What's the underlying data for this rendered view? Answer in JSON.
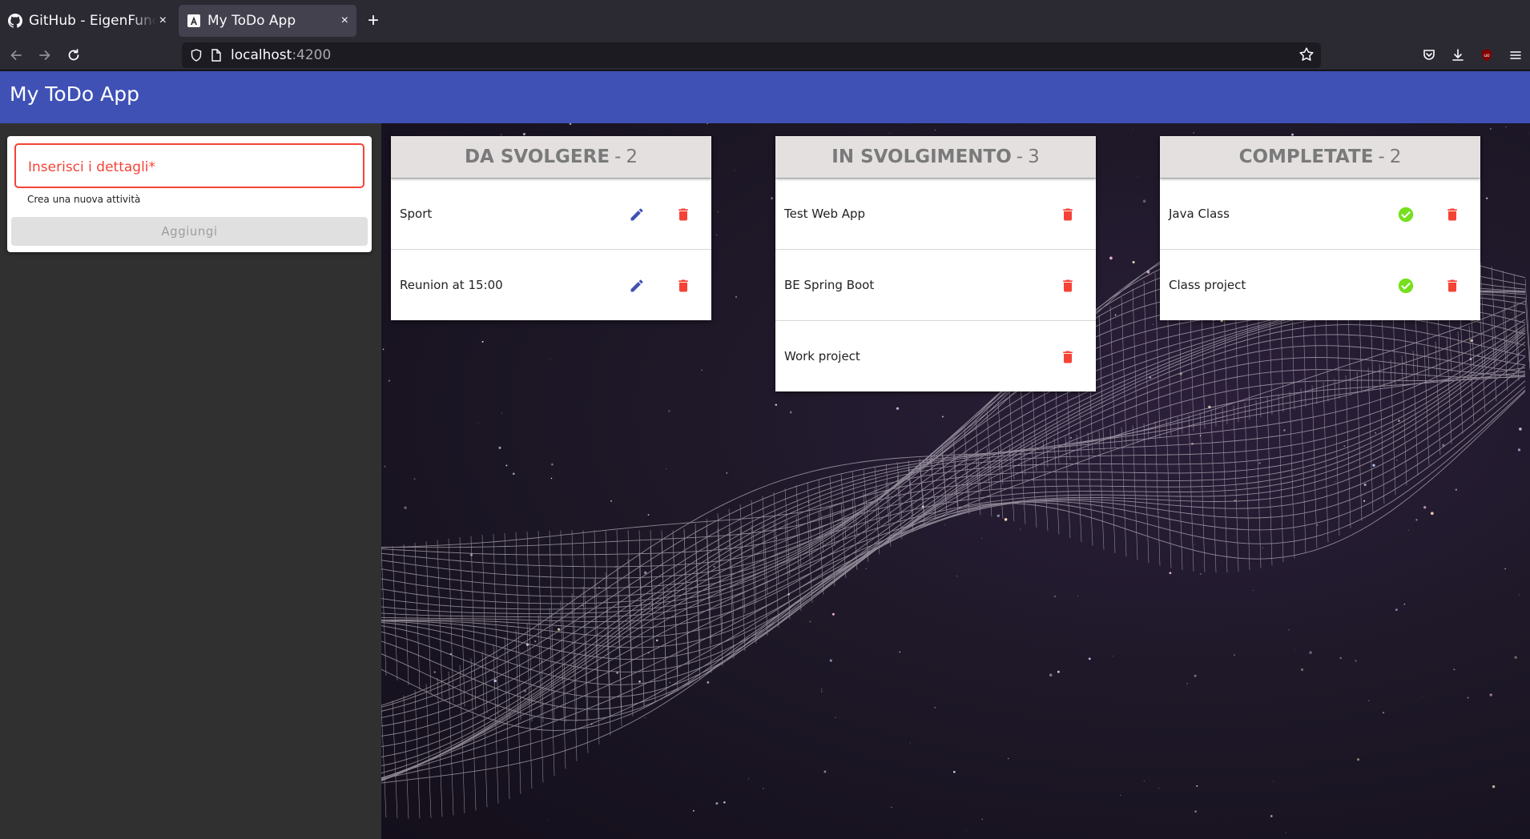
{
  "browser": {
    "tabs": [
      {
        "title": "GitHub - EigenFunction",
        "favicon": "github-icon",
        "active": false
      },
      {
        "title": "My ToDo App",
        "favicon": "angular-icon",
        "active": true
      }
    ],
    "close_glyph": "×",
    "new_tab_glyph": "+",
    "url_host": "localhost",
    "url_port": ":4200"
  },
  "app": {
    "title": "My ToDo App"
  },
  "form": {
    "label": "Inserisci i dettagli*",
    "hint": "Crea una nuova attività",
    "button": "Aggiungi",
    "error_color": "#f44336"
  },
  "columns": [
    {
      "name": "DA SVOLGERE",
      "separator": "-",
      "count": "2",
      "tasks": [
        {
          "label": "Sport"
        },
        {
          "label": "Reunion at 15:00"
        }
      ],
      "actions": [
        "edit-icon",
        "delete-icon"
      ]
    },
    {
      "name": "IN SVOLGIMENTO",
      "separator": "-",
      "count": "3",
      "tasks": [
        {
          "label": "Test Web App"
        },
        {
          "label": "BE Spring Boot"
        },
        {
          "label": "Work project"
        }
      ],
      "actions": [
        "delete-icon"
      ]
    },
    {
      "name": "COMPLETATE",
      "separator": "-",
      "count": "2",
      "tasks": [
        {
          "label": "Java Class"
        },
        {
          "label": "Class project"
        }
      ],
      "actions": [
        "check-icon",
        "delete-icon"
      ]
    }
  ],
  "colors": {
    "toolbar": "#3f51b5",
    "edit": "#3f51b5",
    "delete": "#f44336",
    "done": "#76e01e",
    "header_bg": "#e4e0e0"
  }
}
